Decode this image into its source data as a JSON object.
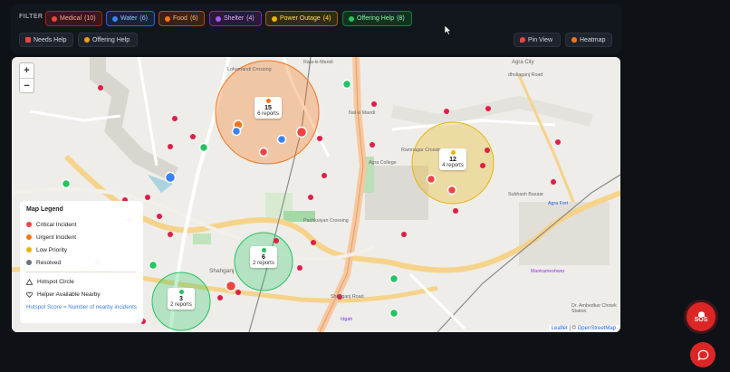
{
  "filter": {
    "label": "FILTER",
    "chips": [
      {
        "label": "Medical",
        "count": "(10)",
        "color": "#ef4444",
        "bg": "#3a1719",
        "border": "#b91c1c",
        "text": "#fca5a5"
      },
      {
        "label": "Water",
        "count": "(6)",
        "color": "#3b82f6",
        "bg": "#172338",
        "border": "#2563eb",
        "text": "#93c5fd"
      },
      {
        "label": "Food",
        "count": "(6)",
        "color": "#f97316",
        "bg": "#3a2214",
        "border": "#c2410c",
        "text": "#fdba74"
      },
      {
        "label": "Shelter",
        "count": "(4)",
        "color": "#a855f7",
        "bg": "#2a1a3a",
        "border": "#7e22ce",
        "text": "#d8b4fe"
      },
      {
        "label": "Power Outage",
        "count": "(4)",
        "color": "#eab308",
        "bg": "#332b12",
        "border": "#a16207",
        "text": "#fde047"
      },
      {
        "label": "Offering Help",
        "count": "(8)",
        "color": "#22c55e",
        "bg": "#13311f",
        "border": "#15803d",
        "text": "#86efac"
      }
    ]
  },
  "toggles": {
    "needs_help": "Needs Help",
    "offering_help": "Offering Help"
  },
  "views": {
    "pin_view": "Pin View",
    "heatmap": "Heatmap"
  },
  "zoom": {
    "in": "+",
    "out": "−"
  },
  "legend": {
    "title": "Map Legend",
    "items": [
      {
        "label": "Critical Incident",
        "color": "#ef4444"
      },
      {
        "label": "Urgent Incident",
        "color": "#f97316"
      },
      {
        "label": "Low Priority",
        "color": "#eab308"
      },
      {
        "label": "Resolved",
        "color": "#6b7280"
      }
    ],
    "hotspot_circle": "Hotspot Circle",
    "helper": "Helper Available Nearby",
    "note": "Hotspot Score = Number of nearby incidents"
  },
  "hotspots": [
    {
      "score": "15",
      "reports": "6 reports",
      "color": "#f97316"
    },
    {
      "score": "12",
      "reports": "4 reports",
      "color": "#eab308"
    },
    {
      "score": "6",
      "reports": "2 reports",
      "color": "#22c55e"
    },
    {
      "score": "3",
      "reports": "2 reports",
      "color": "#22c55e"
    }
  ],
  "places": [
    "Agra City",
    "dhuliaganj Road",
    "Raja-ki-Mandi",
    "Lohamandi Crossing",
    "Nai ki Mandi",
    "Ramnagar Crossing",
    "Agra College",
    "Pachkuiyan Crossing",
    "Subhash Bazaar",
    "Agra Fort",
    "Mankameshwar",
    "Shahganj",
    "Shahganj Road",
    "Idgah",
    "Dr. Ambedkar Chowk Station"
  ],
  "attribution": {
    "leaflet": "Leaflet",
    "osm": "OpenStreetMap"
  },
  "sos": {
    "label": "SOS"
  }
}
